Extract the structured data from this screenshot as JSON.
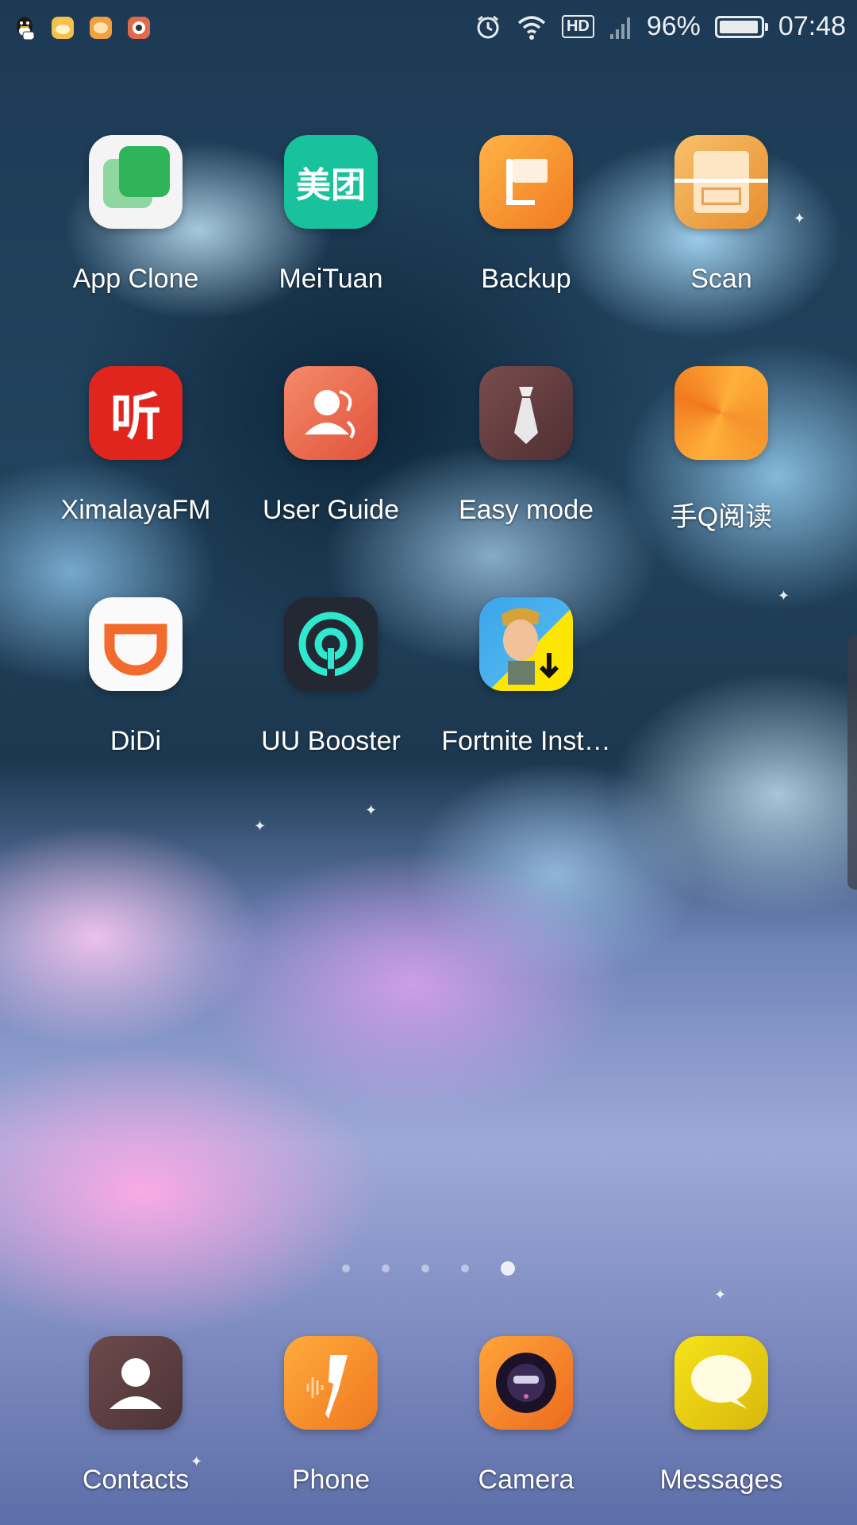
{
  "status_bar": {
    "notifications": [
      {
        "icon": "qq-icon",
        "color": "#2b2b2b"
      },
      {
        "icon": "cloud-app-icon",
        "color": "#f2c14e"
      },
      {
        "icon": "chat-app-icon",
        "color": "#f0a040"
      },
      {
        "icon": "camera-app-icon",
        "color": "#e05a3a"
      }
    ],
    "icons": [
      "alarm-icon",
      "wifi-icon",
      "signal-icon"
    ],
    "hd": "HD",
    "battery_percent": "96%",
    "battery_level": 0.96,
    "time": "07:48"
  },
  "apps": [
    {
      "label": "App Clone",
      "icon": "app-clone-icon"
    },
    {
      "label": "MeiTuan",
      "icon": "meituan-icon",
      "glyph": "美团"
    },
    {
      "label": "Backup",
      "icon": "backup-icon"
    },
    {
      "label": "Scan",
      "icon": "scan-icon"
    },
    {
      "label": "XimalayaFM",
      "icon": "ximalaya-icon",
      "glyph": "听"
    },
    {
      "label": "User Guide",
      "icon": "user-guide-icon"
    },
    {
      "label": "Easy mode",
      "icon": "easy-mode-icon"
    },
    {
      "label": "手Q阅读",
      "icon": "qq-reader-icon"
    },
    {
      "label": "DiDi",
      "icon": "didi-icon"
    },
    {
      "label": "UU Booster",
      "icon": "uu-booster-icon"
    },
    {
      "label": "Fortnite Inst…",
      "icon": "fortnite-installer-icon"
    }
  ],
  "dock": [
    {
      "label": "Contacts",
      "icon": "contacts-icon"
    },
    {
      "label": "Phone",
      "icon": "phone-icon"
    },
    {
      "label": "Camera",
      "icon": "camera-icon"
    },
    {
      "label": "Messages",
      "icon": "messages-icon"
    }
  ],
  "page_indicator": {
    "count": 5,
    "active_index": 4
  }
}
